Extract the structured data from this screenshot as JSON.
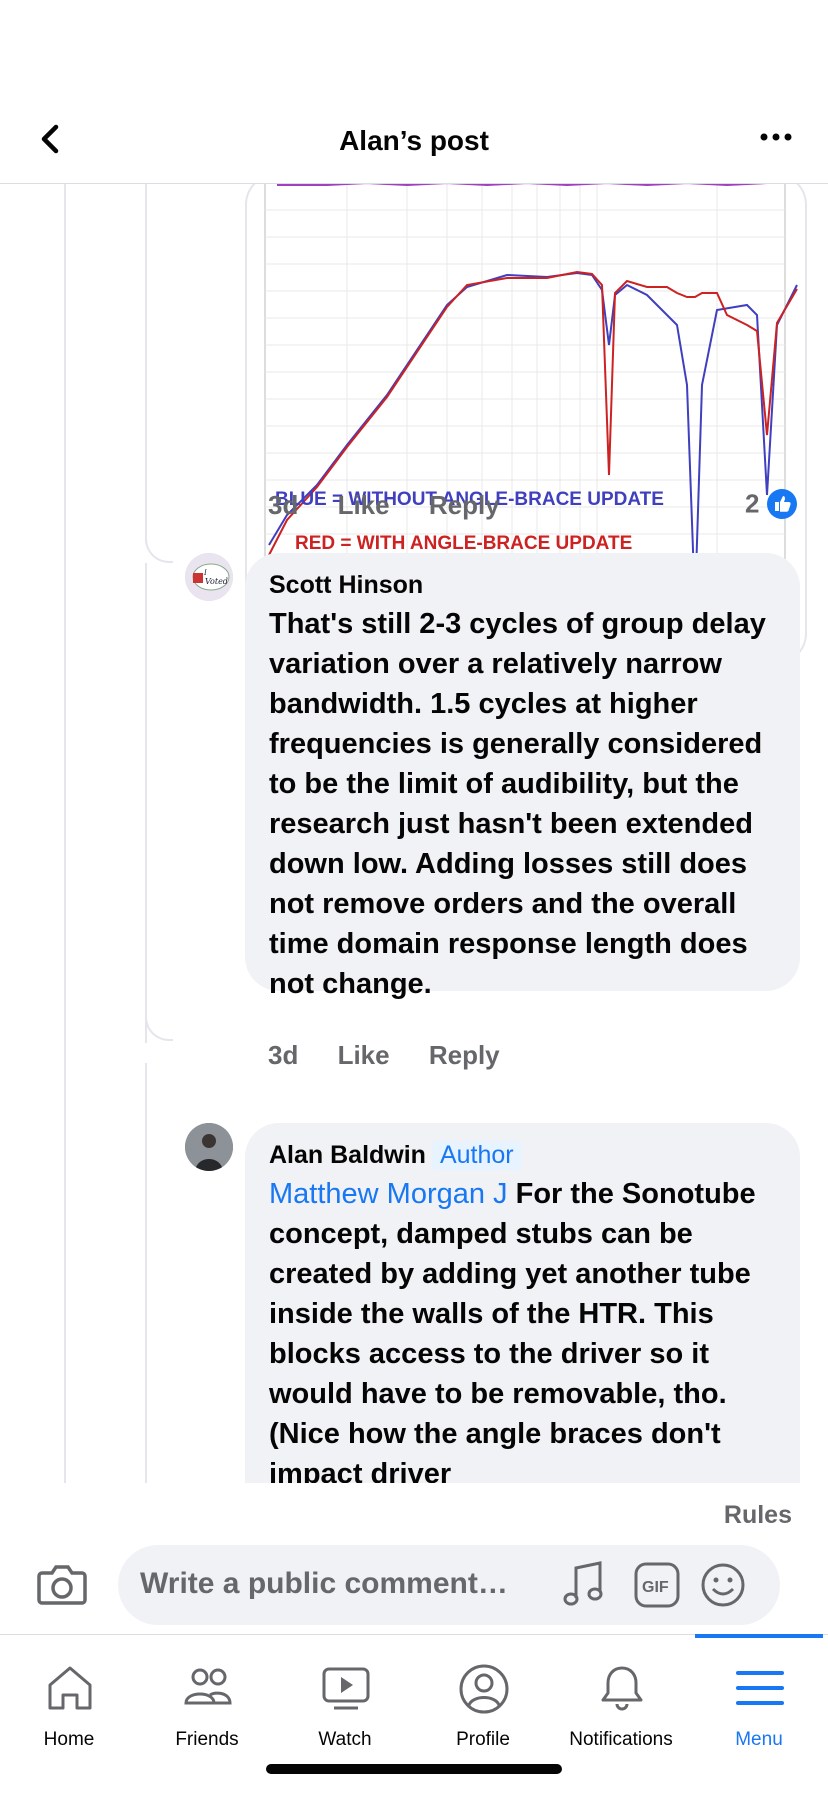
{
  "header": {
    "title": "Alan’s post"
  },
  "image_comment": {
    "blue_label": "BLUE = WITHOUT ANGLE-BRACE UPDATE",
    "red_label": "RED = WITH ANGLE-BRACE UPDATE",
    "time": "3d",
    "like": "Like",
    "reply": "Reply",
    "reaction_count": "2"
  },
  "comments": [
    {
      "author": "Scott Hinson",
      "text": "That's still 2-3 cycles of group delay variation over a relatively narrow bandwidth.  1.5 cycles at higher frequencies is generally considered to be the limit of audibility, but the research just hasn't been extended down low. Adding losses still does not remove orders and the overall time domain response length does not change.",
      "time": "3d",
      "like": "Like",
      "reply": "Reply"
    },
    {
      "author": "Alan Baldwin",
      "badge": "Author",
      "mention": "Matthew Morgan J",
      "text": " For the Sonotube concept, damped stubs can be created by adding yet another tube inside the walls of the HTR. This blocks access to the driver so it would have to be removable, tho.  (Nice how the angle braces don't impact driver"
    }
  ],
  "composer": {
    "rules": "Rules",
    "placeholder": "Write a public comment…"
  },
  "nav": [
    {
      "label": "Home",
      "icon": "home-icon"
    },
    {
      "label": "Friends",
      "icon": "friends-icon"
    },
    {
      "label": "Watch",
      "icon": "watch-icon"
    },
    {
      "label": "Profile",
      "icon": "profile-icon"
    },
    {
      "label": "Notifications",
      "icon": "bell-icon"
    },
    {
      "label": "Menu",
      "icon": "menu-icon",
      "active": true
    }
  ],
  "colors": {
    "accent": "#1877f2",
    "blue_series": "#3f3fbf",
    "red_series": "#cc2222"
  }
}
